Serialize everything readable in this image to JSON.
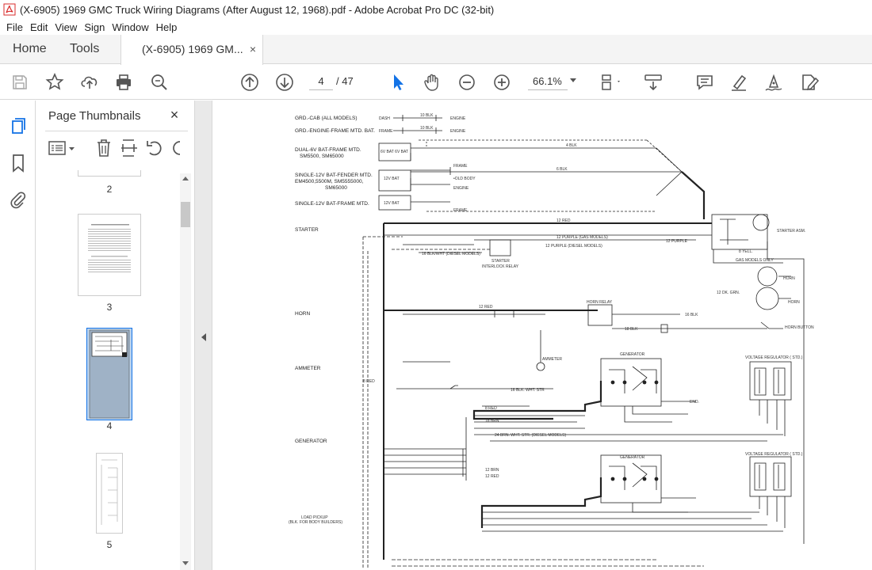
{
  "window": {
    "title": "(X-6905) 1969 GMC Truck Wiring Diagrams (After August 12, 1968).pdf - Adobe Acrobat Pro DC (32-bit)",
    "app_icon": "acrobat-icon"
  },
  "menu": {
    "items": [
      "File",
      "Edit",
      "View",
      "Sign",
      "Window",
      "Help"
    ]
  },
  "tabs": {
    "home": "Home",
    "tools": "Tools",
    "document": "(X-6905) 1969 GM...",
    "close": "×"
  },
  "toolbar": {
    "page_current": "4",
    "page_total": "/ 47",
    "zoom": "66.1%",
    "icons": [
      "save-icon",
      "bookmark-star-icon",
      "share-upload-icon",
      "print-icon",
      "search-zoom-icon",
      "page-up-icon",
      "page-down-icon",
      "select-cursor-icon",
      "hand-icon",
      "zoom-out-icon",
      "zoom-in-icon",
      "page-display-icon",
      "scroll-mode-icon",
      "comment-icon",
      "highlight-icon",
      "sign-icon",
      "fill-sign-icon"
    ]
  },
  "side_panel": {
    "title": "Page Thumbnails",
    "close": "×",
    "thumbnails": [
      {
        "label": "2"
      },
      {
        "label": "3"
      },
      {
        "label": "4",
        "selected": true
      },
      {
        "label": "5"
      }
    ]
  },
  "diagram": {
    "left_labels": [
      "GRD.-CAB (ALL MODELS)",
      "GRD.-ENGINE-FRAME MTD. BAT.",
      "DUAL-6V BAT-FRAME MTD.",
      "SM5500, SM65000",
      "SINGLE-12V BAT-FENDER MTD.",
      "EM4500,5500M, SM5555000,",
      "SM65000",
      "SINGLE-12V BAT-FRAME MTD.",
      "STARTER",
      "HORN",
      "AMMETER",
      "GENERATOR",
      "LOAD PICKUP",
      "(BLK. FOR BODY BUILDERS)"
    ],
    "labels": {
      "dash": "DASH",
      "engine": "ENGINE",
      "frame": "FRAME",
      "engine2": "ENGINE",
      "frame2": "FRAME",
      "frame3": "FRAME",
      "bat6v": "6V BAT  6V BAT",
      "bat12v": "12V BAT",
      "bat12v_b": "12V BAT",
      "cab_body": "•OLD BODY",
      "starter_asm": "STARTER ASM.",
      "starter_relay": "STARTER",
      "interlock": "INTERLOCK RELAY",
      "gas_models_only": "GAS MODELS ONLY",
      "horn_relay": "HORN RELAY",
      "horn": "HORN",
      "horn2": "HORN",
      "horn_button": "HORN BUTTON",
      "ammeter": "AMMETER",
      "generator": "GENERATOR",
      "generator2": "GENERATOR",
      "voltage_reg": "VOLTAGE REGULATOR ( STD.)",
      "voltage_reg2": "VOLTAGE REGULATOR ( STD.)",
      "end": "END."
    },
    "wire_labels": [
      "10 BLK",
      "10 BLK",
      "6 BLK",
      "4 BLK",
      "12 RED",
      "12 PURPLE",
      "12 PURPLE (GAS MODELS)",
      "12 PURPLE (DIESEL MODELS)",
      "16 BLK/WHT (DIESEL MODELS)",
      "12 DK. GRN.",
      "16 BLK",
      "18 BLK",
      "8 RED",
      "12 RED",
      "16 BLK. WHT. STR",
      "8 RED",
      "18 BRN",
      "12 BRN",
      "12 RED",
      "24 BRN. WHT. STR. (DIESEL MODELS)",
      "8 YELL."
    ]
  }
}
